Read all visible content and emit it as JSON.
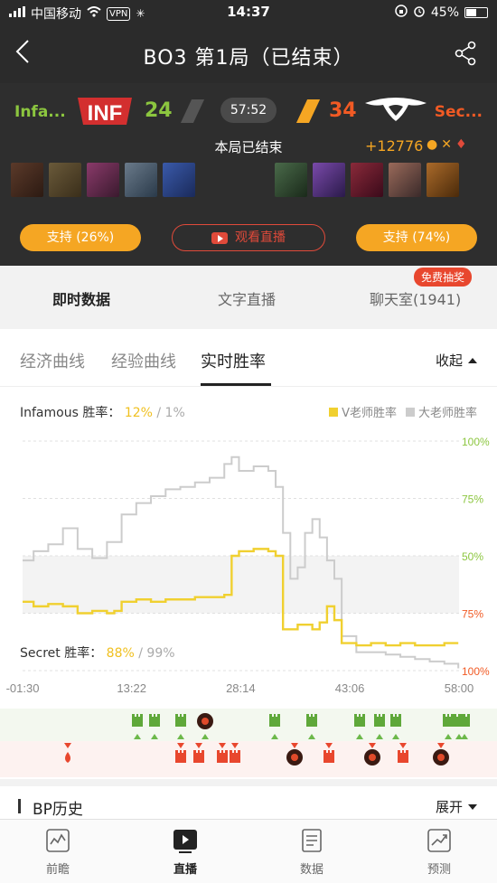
{
  "status_bar": {
    "carrier": "中国移动",
    "vpn": "VPN",
    "time": "14:37",
    "battery": "45%"
  },
  "header": {
    "title": "BO3   第1局（已结束）"
  },
  "match": {
    "team_a": {
      "name": "Infa...",
      "score": "24",
      "logo_text": "INF",
      "color": "#8cc63f"
    },
    "team_b": {
      "name": "Sec...",
      "score": "34",
      "color": "#f15a24"
    },
    "timer": "57:52",
    "status": "本局已结束",
    "gold_diff": "+12776",
    "support_a": "支持 (26%)",
    "support_b": "支持 (74%)",
    "watch_live": "观看直播"
  },
  "main_tabs": {
    "live_data": "即时数据",
    "text_live": "文字直播",
    "chat": "聊天室(1941)",
    "lottery_badge": "免费抽奖"
  },
  "sub_tabs": {
    "economy": "经济曲线",
    "experience": "经验曲线",
    "winrate": "实时胜率",
    "collapse": "收起"
  },
  "chart_head": {
    "team_a_label": "Infamous 胜率：",
    "team_a_v": "12%",
    "sep": " / ",
    "team_a_d": "1%",
    "team_b_label": "Secret 胜率：",
    "team_b_v": "88%",
    "team_b_d": "99%",
    "legend_v": "V老师胜率",
    "legend_d": "大老师胜率"
  },
  "chart_data": {
    "type": "line",
    "x_tick_labels": [
      "-01:30",
      "13:22",
      "28:14",
      "43:06",
      "58:00"
    ],
    "xlim": [
      -1.5,
      58.0
    ],
    "y_tick_labels": [
      "100%",
      "75%",
      "50%",
      "75%",
      "100%"
    ],
    "ylim": [
      0,
      100
    ],
    "series": [
      {
        "name": "V老师胜率",
        "color": "#f0d030",
        "x": [
          -1.5,
          0,
          2,
          4,
          6,
          8,
          10,
          11,
          12,
          14,
          16,
          18,
          20,
          22,
          24,
          26,
          27,
          28,
          30,
          32,
          33,
          34,
          36,
          38,
          39,
          40,
          41,
          42,
          44,
          46,
          48,
          50,
          52,
          54,
          56,
          57.9
        ],
        "y": [
          30,
          28,
          29,
          28,
          25,
          26,
          25,
          26,
          30,
          31,
          30,
          31,
          31,
          32,
          32,
          33,
          50,
          52,
          53,
          52,
          50,
          18,
          20,
          18,
          21,
          28,
          22,
          12,
          11,
          12,
          11,
          12,
          11,
          11,
          12,
          12
        ]
      },
      {
        "name": "大老师胜率",
        "color": "#cccccc",
        "x": [
          -1.5,
          0,
          2,
          4,
          6,
          8,
          10,
          12,
          14,
          16,
          18,
          20,
          22,
          24,
          26,
          27,
          28,
          30,
          32,
          33,
          34,
          35,
          36,
          37,
          38,
          39,
          40,
          41,
          42,
          44,
          46,
          48,
          50,
          52,
          54,
          56,
          57.9
        ],
        "y": [
          48,
          52,
          55,
          62,
          53,
          49,
          56,
          68,
          73,
          76,
          79,
          80,
          82,
          84,
          90,
          93,
          87,
          89,
          87,
          80,
          60,
          40,
          45,
          60,
          66,
          58,
          48,
          40,
          15,
          8,
          8,
          7,
          6,
          5,
          4,
          3,
          1
        ]
      }
    ],
    "grid": true,
    "legend": "top-right"
  },
  "event_row_a": [
    "tower",
    "tower",
    "tower",
    "tower",
    "roshan",
    "tower",
    "tower",
    "tower",
    "tower",
    "tower",
    "tower",
    "tower",
    "tower"
  ],
  "event_row_b": [
    "first-blood",
    "tower",
    "tower",
    "rax",
    "roshan",
    "tower",
    "roshan",
    "tower",
    "roshan"
  ],
  "bp": {
    "title": "BP历史",
    "expand": "展开"
  },
  "bottom_nav": {
    "preview": "前瞻",
    "live": "直播",
    "data": "数据",
    "predict": "预测"
  },
  "colors": {
    "dark_bg": "#2e2e2e",
    "accent": "#f5a623",
    "red": "#e04a3a",
    "green": "#8cc63f"
  }
}
